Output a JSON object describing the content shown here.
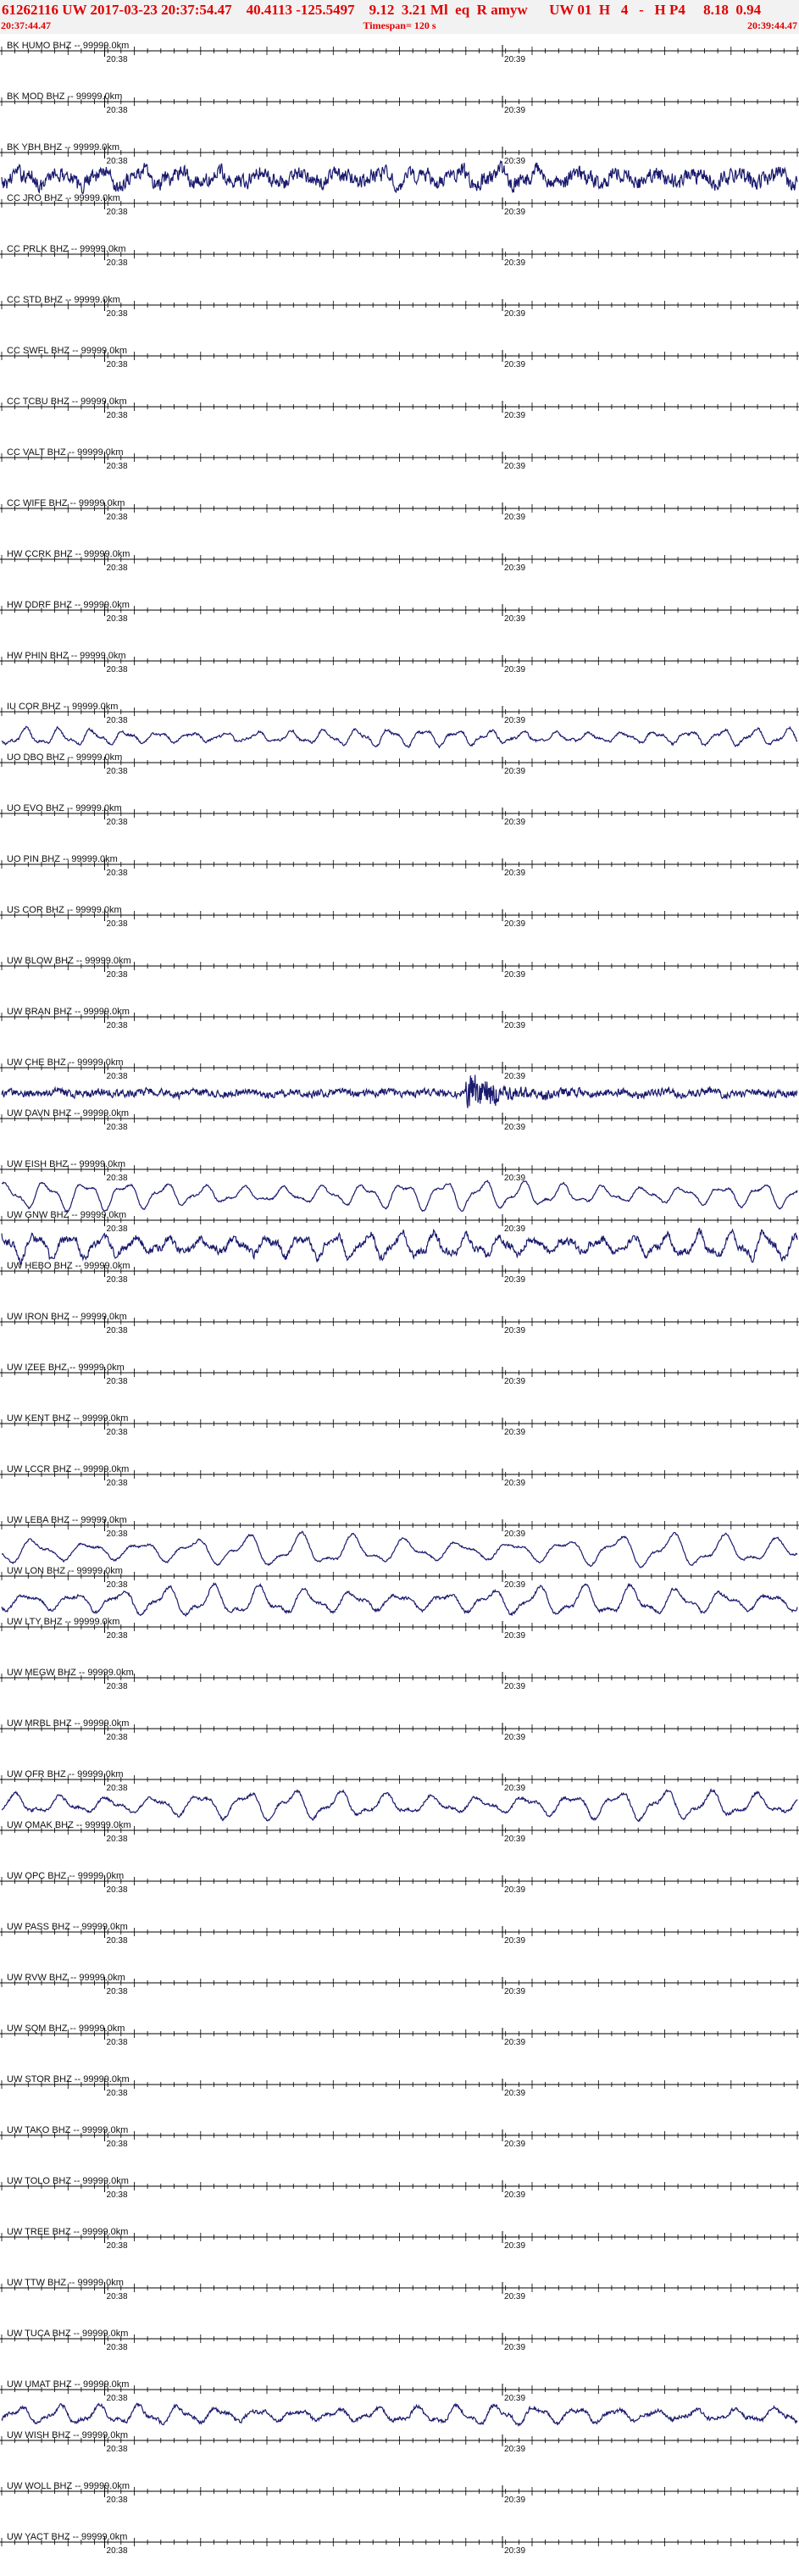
{
  "header": {
    "title": "61262116 UW 2017-03-23 20:37:54.47    40.4113 -125.5497    9.12  3.21 Ml  eq  R amyw      UW 01  H   4   -   H P4     8.18  0.94",
    "start_time": "20:37:44.47",
    "timespan": "Timespan= 120 s",
    "end_time": "20:39:44.47"
  },
  "chart_data": {
    "type": "line",
    "title": "61262116 UW 2017-03-23 20:37:54.47",
    "xlabel": "",
    "ylabel": "",
    "x_range_seconds": [
      0,
      120
    ],
    "time_ticks": [
      {
        "label": "20:38",
        "seconds": 15.53
      },
      {
        "label": "20:39",
        "seconds": 75.53
      }
    ],
    "trace_color": "#1a1a6e",
    "grid": false,
    "series": [
      {
        "name": "BK HUMO BHZ -- 99999.0km",
        "amp": 0,
        "period": 0,
        "noise": 0,
        "burst": 0
      },
      {
        "name": "BK MOD BHZ -- 99999.0km",
        "amp": 0,
        "period": 0,
        "noise": 0,
        "burst": 0
      },
      {
        "name": "BK YBH BHZ -- 99999.0km",
        "amp": 0.45,
        "period": 6,
        "noise": 0.6,
        "burst": 0
      },
      {
        "name": "CC JRO BHZ -- 99999.0km",
        "amp": 0,
        "period": 0,
        "noise": 0,
        "burst": 0
      },
      {
        "name": "CC PRLK BHZ -- 99999.0km",
        "amp": 0,
        "period": 0,
        "noise": 0,
        "burst": 0
      },
      {
        "name": "CC STD BHZ -- 99999.0km",
        "amp": 0,
        "period": 0,
        "noise": 0,
        "burst": 0
      },
      {
        "name": "CC SWFL BHZ -- 99999.0km",
        "amp": 0,
        "period": 0,
        "noise": 0,
        "burst": 0
      },
      {
        "name": "CC TCBU BHZ -- 99999.0km",
        "amp": 0,
        "period": 0,
        "noise": 0,
        "burst": 0
      },
      {
        "name": "CC VALT BHZ -- 99999.0km",
        "amp": 0,
        "period": 0,
        "noise": 0,
        "burst": 0
      },
      {
        "name": "CC WIFE BHZ -- 99999.0km",
        "amp": 0,
        "period": 0,
        "noise": 0,
        "burst": 0
      },
      {
        "name": "HW CCRK BHZ -- 99999.0km",
        "amp": 0,
        "period": 0,
        "noise": 0,
        "burst": 0
      },
      {
        "name": "HW DDRF BHZ -- 99999.0km",
        "amp": 0,
        "period": 0,
        "noise": 0,
        "burst": 0
      },
      {
        "name": "HW PHIN BHZ -- 99999.0km",
        "amp": 0,
        "period": 0,
        "noise": 0,
        "burst": 0
      },
      {
        "name": "IU COR BHZ -- 99999.0km",
        "amp": 0.45,
        "period": 5,
        "noise": 0.1,
        "burst": 0
      },
      {
        "name": "UO DBO BHZ -- 99999.0km",
        "amp": 0,
        "period": 0,
        "noise": 0,
        "burst": 0
      },
      {
        "name": "UO EVO BHZ -- 99999.0km",
        "amp": 0,
        "period": 0,
        "noise": 0,
        "burst": 0
      },
      {
        "name": "UO PIN BHZ -- 99999.0km",
        "amp": 0,
        "period": 0,
        "noise": 0,
        "burst": 0
      },
      {
        "name": "US COR BHZ -- 99999.0km",
        "amp": 0,
        "period": 0,
        "noise": 0,
        "burst": 0
      },
      {
        "name": "UW BLOW BHZ -- 99999.0km",
        "amp": 0,
        "period": 0,
        "noise": 0,
        "burst": 0
      },
      {
        "name": "UW BRAN BHZ -- 99999.0km",
        "amp": 0,
        "period": 0,
        "noise": 0,
        "burst": 0
      },
      {
        "name": "UW CHE BHZ -- 99999.0km",
        "amp": 0.12,
        "period": 7,
        "noise": 0.3,
        "burst": 1
      },
      {
        "name": "UW DAVN BHZ -- 99999.0km",
        "amp": 0,
        "period": 0,
        "noise": 0,
        "burst": 0
      },
      {
        "name": "UW EISH BHZ -- 99999.0km",
        "amp": 0.75,
        "period": 6,
        "noise": 0.08,
        "burst": 0
      },
      {
        "name": "UW GNW BHZ -- 99999.0km",
        "amp": 0.7,
        "period": 5,
        "noise": 0.3,
        "burst": 0
      },
      {
        "name": "UW HEBO BHZ -- 99999.0km",
        "amp": 0,
        "period": 0,
        "noise": 0,
        "burst": 0
      },
      {
        "name": "UW IRON BHZ -- 99999.0km",
        "amp": 0,
        "period": 0,
        "noise": 0,
        "burst": 0
      },
      {
        "name": "UW IZEE BHZ -- 99999.0km",
        "amp": 0,
        "period": 0,
        "noise": 0,
        "burst": 0
      },
      {
        "name": "UW KENT BHZ -- 99999.0km",
        "amp": 0,
        "period": 0,
        "noise": 0,
        "burst": 0
      },
      {
        "name": "UW LCCR BHZ -- 99999.0km",
        "amp": 0,
        "period": 0,
        "noise": 0,
        "burst": 0
      },
      {
        "name": "UW LEBA BHZ -- 99999.0km",
        "amp": 0.85,
        "period": 8,
        "noise": 0.08,
        "burst": 0
      },
      {
        "name": "UW LON BHZ -- 99999.0km",
        "amp": 0.8,
        "period": 7,
        "noise": 0.12,
        "burst": 0
      },
      {
        "name": "UW LTY BHZ -- 99999.0km",
        "amp": 0,
        "period": 0,
        "noise": 0,
        "burst": 0
      },
      {
        "name": "UW MEGW BHZ -- 99999.0km",
        "amp": 0,
        "period": 0,
        "noise": 0,
        "burst": 0
      },
      {
        "name": "UW MRBL BHZ -- 99999.0km",
        "amp": 0,
        "period": 0,
        "noise": 0,
        "burst": 0
      },
      {
        "name": "UW OFR BHZ -- 99999.0km",
        "amp": 0.75,
        "period": 7,
        "noise": 0.12,
        "burst": 0
      },
      {
        "name": "UW OMAK BHZ -- 99999.0km",
        "amp": 0,
        "period": 0,
        "noise": 0,
        "burst": 0
      },
      {
        "name": "UW OPC BHZ -- 99999.0km",
        "amp": 0,
        "period": 0,
        "noise": 0,
        "burst": 0
      },
      {
        "name": "UW PASS BHZ -- 99999.0km",
        "amp": 0,
        "period": 0,
        "noise": 0,
        "burst": 0
      },
      {
        "name": "UW RVW BHZ -- 99999.0km",
        "amp": 0,
        "period": 0,
        "noise": 0,
        "burst": 0
      },
      {
        "name": "UW SQM BHZ -- 99999.0km",
        "amp": 0,
        "period": 0,
        "noise": 0,
        "burst": 0
      },
      {
        "name": "UW STOR BHZ -- 99999.0km",
        "amp": 0,
        "period": 0,
        "noise": 0,
        "burst": 0
      },
      {
        "name": "UW TAKO BHZ -- 99999.0km",
        "amp": 0,
        "period": 0,
        "noise": 0,
        "burst": 0
      },
      {
        "name": "UW TOLO BHZ -- 99999.0km",
        "amp": 0,
        "period": 0,
        "noise": 0,
        "burst": 0
      },
      {
        "name": "UW TREE BHZ -- 99999.0km",
        "amp": 0,
        "period": 0,
        "noise": 0,
        "burst": 0
      },
      {
        "name": "UW TTW BHZ -- 99999.0km",
        "amp": 0,
        "period": 0,
        "noise": 0,
        "burst": 0
      },
      {
        "name": "UW TUCA BHZ -- 99999.0km",
        "amp": 0,
        "period": 0,
        "noise": 0,
        "burst": 0
      },
      {
        "name": "UW UMAT BHZ -- 99999.0km",
        "amp": 0.5,
        "period": 6,
        "noise": 0.15,
        "burst": 0
      },
      {
        "name": "UW WISH BHZ -- 99999.0km",
        "amp": 0,
        "period": 0,
        "noise": 0,
        "burst": 0
      },
      {
        "name": "UW WOLL BHZ -- 99999.0km",
        "amp": 0,
        "period": 0,
        "noise": 0,
        "burst": 0
      },
      {
        "name": "UW YACT BHZ -- 99999.0km",
        "amp": 0,
        "period": 0,
        "noise": 0,
        "burst": 0
      }
    ]
  }
}
